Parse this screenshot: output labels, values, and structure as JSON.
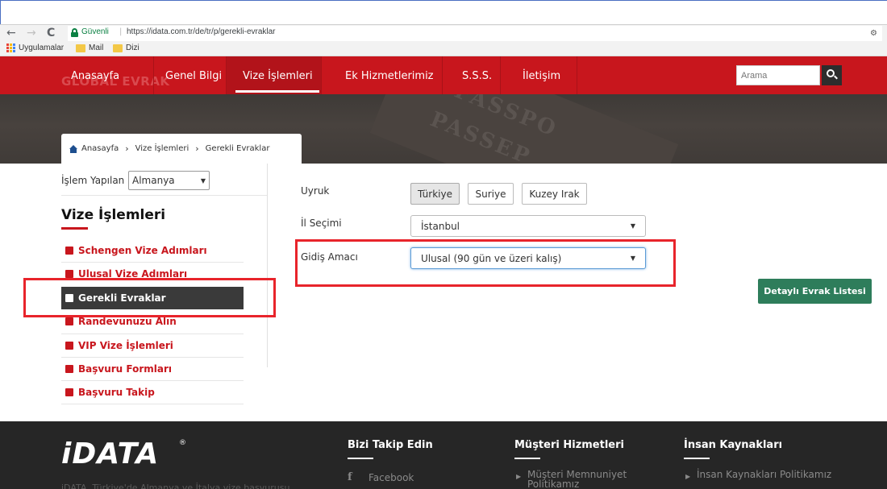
{
  "browser": {
    "back": "←",
    "forward": "→",
    "reload": "C",
    "secure_label": "Güvenli",
    "separator": "|",
    "url": "https://idata.com.tr/de/tr/p/gerekli-evraklar",
    "bookmarks": [
      {
        "label": "Uygulamalar",
        "icon": "apps-icon"
      },
      {
        "label": "Mail",
        "icon": "folder-icon"
      },
      {
        "label": "Dizi",
        "icon": "folder-icon"
      }
    ]
  },
  "nav": {
    "logo_ghost": "GLOBAL EVRAK",
    "items": [
      "Anasayfa",
      "Genel Bilgi",
      "Vize İşlemleri",
      "Ek Hizmetlerimiz",
      "S.S.S.",
      "İletişim"
    ],
    "active_index": 2,
    "search_placeholder": "Arama",
    "accent_color": "#c8161d"
  },
  "hero": {
    "passport_text_1": "PASSPO",
    "passport_text_2": "PASSEP"
  },
  "breadcrumb": [
    "Anasayfa",
    "Vize İşlemleri",
    "Gerekli Evraklar"
  ],
  "breadcrumb_sep": "›",
  "sidebar": {
    "country_label": "İşlem Yapılan Ülke:",
    "country_value": "Almanya",
    "title": "Vize İşlemleri",
    "items": [
      {
        "label": "Schengen Vize Adımları",
        "active": false
      },
      {
        "label": "Ulusal Vize Adımları",
        "active": false
      },
      {
        "label": "Gerekli Evraklar",
        "active": true
      },
      {
        "label": "Randevunuzu Alın",
        "active": false
      },
      {
        "label": "VIP Vize İşlemleri",
        "active": false
      },
      {
        "label": "Başvuru Formları",
        "active": false
      },
      {
        "label": "Başvuru Takip",
        "active": false
      }
    ]
  },
  "form": {
    "nationality_label": "Uyruk",
    "nationality_options": [
      "Türkiye",
      "Suriye",
      "Kuzey Irak"
    ],
    "nationality_selected": "Türkiye",
    "city_label": "İl Seçimi",
    "city_value": "İstanbul",
    "purpose_label": "Gidiş Amacı",
    "purpose_value": "Ulusal (90 gün ve üzeri kalış)",
    "detail_button": "Detaylı Evrak Listesi",
    "button_color": "#2e7d5b"
  },
  "footer": {
    "logo": "iDATA",
    "registered": "®",
    "tagline": "iDATA, Türkiye'de Almanya ve İtalya vize başvurusu",
    "columns": [
      {
        "heading": "Bizi Takip Edin",
        "links": [
          "Facebook"
        ],
        "icons": [
          "facebook-icon"
        ]
      },
      {
        "heading": "Müşteri Hizmetleri",
        "links": [
          "Müşteri Memnuniyet Politikamız"
        ]
      },
      {
        "heading": "İnsan Kaynakları",
        "links": [
          "İnsan Kaynakları Politikamız"
        ]
      }
    ]
  }
}
